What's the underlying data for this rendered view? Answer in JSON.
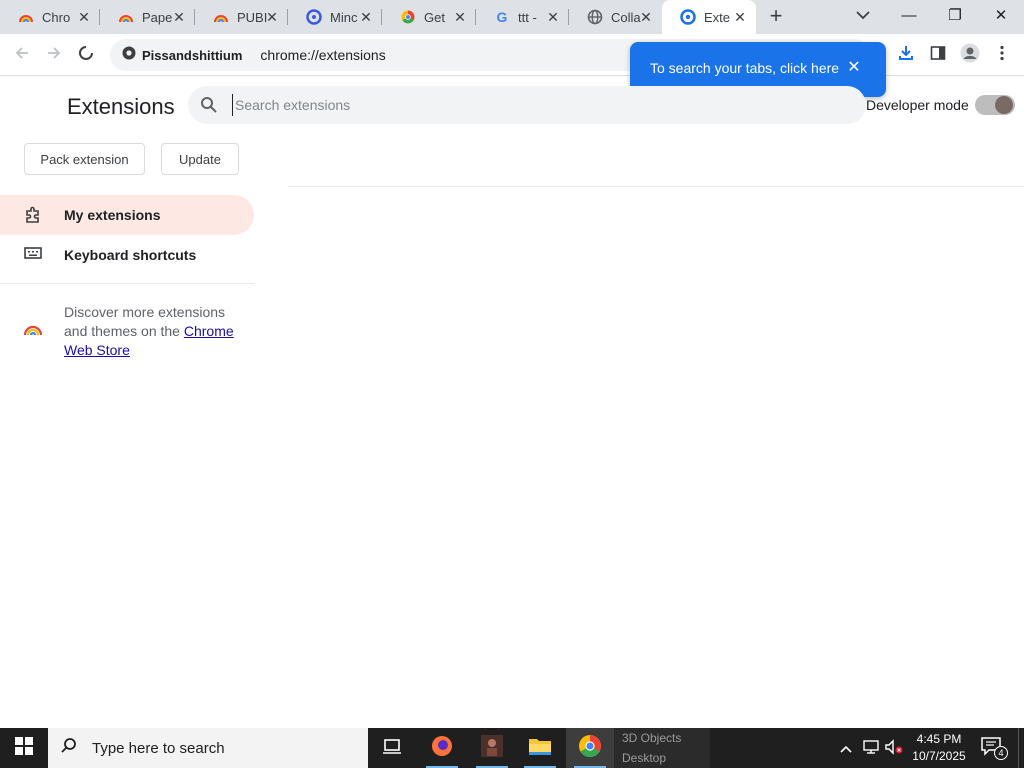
{
  "browser": {
    "tabs": [
      {
        "title": "Chro",
        "icon": "rainbow-cloud-icon",
        "active": false
      },
      {
        "title": "Pape",
        "icon": "rainbow-cloud-icon",
        "active": false
      },
      {
        "title": "PUBI",
        "icon": "rainbow-cloud-icon",
        "active": false
      },
      {
        "title": "Minc",
        "icon": "blue-circle-icon",
        "active": false
      },
      {
        "title": "Get ",
        "icon": "chrome-icon",
        "active": false
      },
      {
        "title": "ttt - ",
        "icon": "google-icon",
        "active": false
      },
      {
        "title": "Colla",
        "icon": "globe-icon",
        "active": false
      },
      {
        "title": "Exte",
        "icon": "extensions-icon",
        "active": true
      }
    ],
    "tab_close_glyph": "✕",
    "new_tab_glyph": "+",
    "window_controls": {
      "minimize": "—",
      "restore": "❐",
      "close": "✕"
    },
    "toolbar": {
      "site_chip_label": "Pissandshittium",
      "url": "chrome://extensions"
    },
    "tab_search_callout": {
      "text": "To search your tabs, click here",
      "close_glyph": "✕"
    }
  },
  "extensions_page": {
    "title": "Extensions",
    "search_placeholder": "Search extensions",
    "developer_mode_label": "Developer mode",
    "developer_mode_on": true,
    "buttons": {
      "pack": "Pack extension",
      "update": "Update"
    },
    "nav": [
      {
        "label": "My extensions",
        "selected": true,
        "icon": "puzzle-piece-icon"
      },
      {
        "label": "Keyboard shortcuts",
        "selected": false,
        "icon": "keyboard-icon"
      }
    ],
    "discover_text": "Discover more extensions and themes on the ",
    "webstore_link": "Chrome Web Store"
  },
  "taskbar": {
    "search_placeholder": "Type here to search",
    "jumplist_items": [
      "3D Objects",
      "Desktop"
    ],
    "clock_time": "4:45 PM",
    "clock_date": "10/7/2025",
    "notification_count": "4"
  },
  "colors": {
    "accent_blue": "#1a73e8",
    "selected_nav_bg": "#fde8e4",
    "tabstrip_bg": "#dee1e6",
    "taskbar_bg": "#1f1f1f"
  }
}
